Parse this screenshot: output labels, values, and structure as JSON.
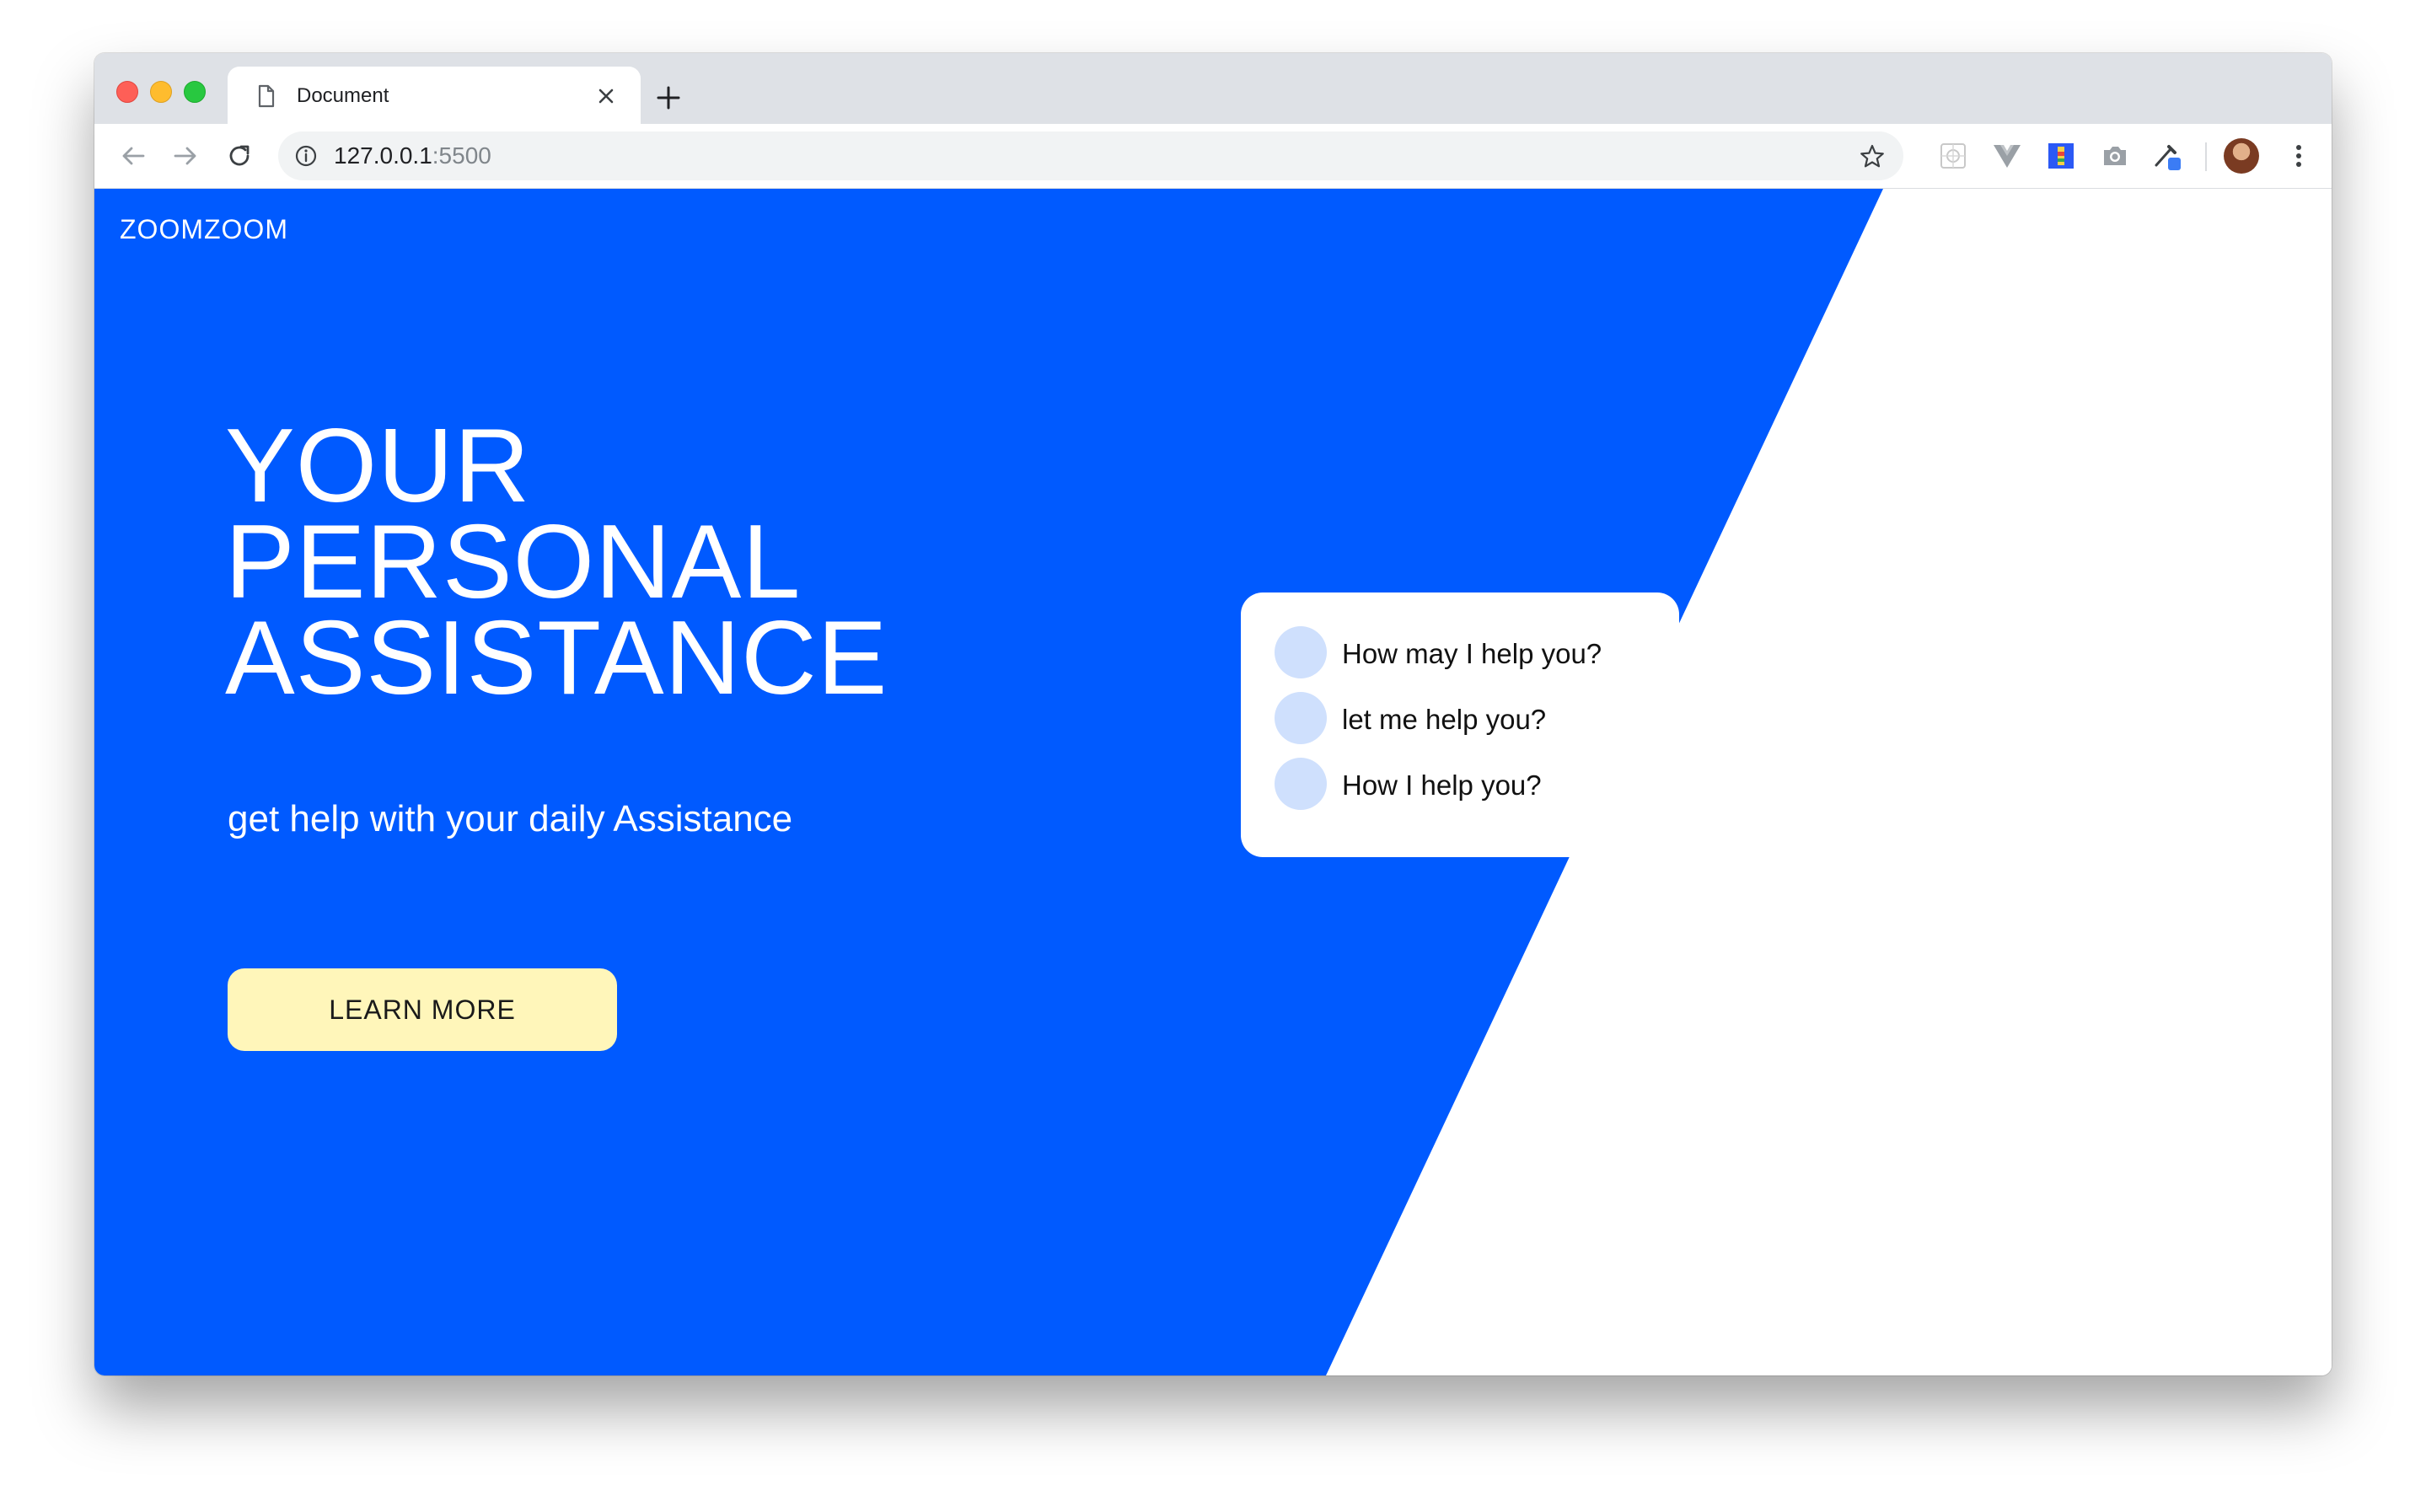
{
  "browser": {
    "tab": {
      "title": "Document"
    },
    "address": {
      "host": "127.0.0.1",
      "port": ":5500"
    },
    "icons": [
      "document-icon",
      "close-icon",
      "plus-icon",
      "back-icon",
      "forward-icon",
      "reload-icon",
      "info-icon",
      "star-icon",
      "extension-icons",
      "profile-avatar",
      "more-menu-icon"
    ]
  },
  "page": {
    "logo": "ZOOMZOOM",
    "headline": [
      "YOUR",
      "PERSONAL",
      "ASSISTANCE"
    ],
    "subtitle": "get help with your daily Assistance",
    "cta_label": "LEARN MORE",
    "chat": [
      "How may I help you?",
      "let me help you?",
      "How I help you?"
    ]
  },
  "colors": {
    "hero_blue": "#005aff",
    "cta_bg": "#fff6ba",
    "chat_dot": "#cfe0fd"
  }
}
